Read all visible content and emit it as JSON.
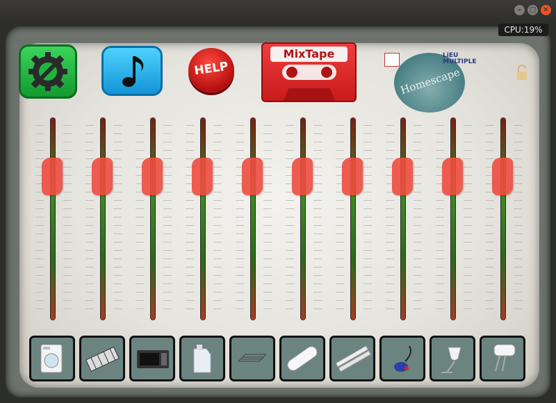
{
  "window": {
    "minimize_icon": "minimize-icon",
    "maximize_icon": "maximize-icon",
    "close_icon": "close-icon",
    "minimize_glyph": "–",
    "maximize_glyph": "□",
    "close_glyph": "✕"
  },
  "status": {
    "cpu": "CPU:19%"
  },
  "toolbar": {
    "settings_icon": "settings-wrench-gear-icon",
    "music_icon": "music-note-icon",
    "help_label": "HELP",
    "mixtape_label": "MixTape"
  },
  "branding": {
    "homescape_label": "Homescape",
    "lieu_label_1": "LiEU",
    "lieu_label_2": "MULTIPLE"
  },
  "colors": {
    "settings": "#1fb43f",
    "music": "#2bb3ee",
    "help": "#d91b1b",
    "mixtape": "#e02b2b",
    "knob": "#ef4d40",
    "pad": "#6c8480"
  },
  "faders": [
    {
      "name": "fader-1",
      "level": 0.76
    },
    {
      "name": "fader-2",
      "level": 0.76
    },
    {
      "name": "fader-3",
      "level": 0.76
    },
    {
      "name": "fader-4",
      "level": 0.76
    },
    {
      "name": "fader-5",
      "level": 0.76
    },
    {
      "name": "fader-6",
      "level": 0.76
    },
    {
      "name": "fader-7",
      "level": 0.76
    },
    {
      "name": "fader-8",
      "level": 0.76
    },
    {
      "name": "fader-9",
      "level": 0.76
    },
    {
      "name": "fader-10",
      "level": 0.76
    }
  ],
  "pads": [
    {
      "icon": "washing-machine-icon"
    },
    {
      "icon": "cutlery-tray-icon"
    },
    {
      "icon": "microwave-icon"
    },
    {
      "icon": "plastic-jerrycan-icon"
    },
    {
      "icon": "wire-rack-icon"
    },
    {
      "icon": "bathtub-icon"
    },
    {
      "icon": "ruler-sticks-icon"
    },
    {
      "icon": "vacuum-cleaner-icon"
    },
    {
      "icon": "wine-glass-icon"
    },
    {
      "icon": "hand-mixer-icon"
    }
  ]
}
